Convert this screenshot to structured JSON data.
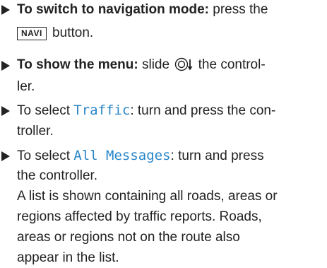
{
  "steps": [
    {
      "lines": [
        {
          "lead_bold": "To switch to navigation mode:",
          "text": " press the"
        },
        {
          "key": "NAVI",
          "text": " button."
        }
      ]
    },
    {
      "lines": [
        {
          "lead_bold": "To show the menu:",
          "text_before_icon": " slide ",
          "icon": "controller-slide-down-icon",
          "text": " the control-"
        },
        {
          "text": "ler."
        }
      ]
    },
    {
      "lines": [
        {
          "text_before_mono": "To select ",
          "mono": "Traffic",
          "text": ": turn and press the con-"
        },
        {
          "text": "troller."
        }
      ]
    },
    {
      "lines": [
        {
          "text_before_mono": "To select ",
          "mono": "All Messages",
          "text": ": turn and press"
        },
        {
          "text": "the controller."
        },
        {
          "text": "A list is shown containing all roads, areas or"
        },
        {
          "text": "regions affected by traffic reports. Roads,"
        },
        {
          "text": "areas or regions not on the route also"
        },
        {
          "text": "appear in the list."
        }
      ]
    }
  ],
  "colors": {
    "text": "#222222",
    "highlight": "#2a86c8"
  }
}
